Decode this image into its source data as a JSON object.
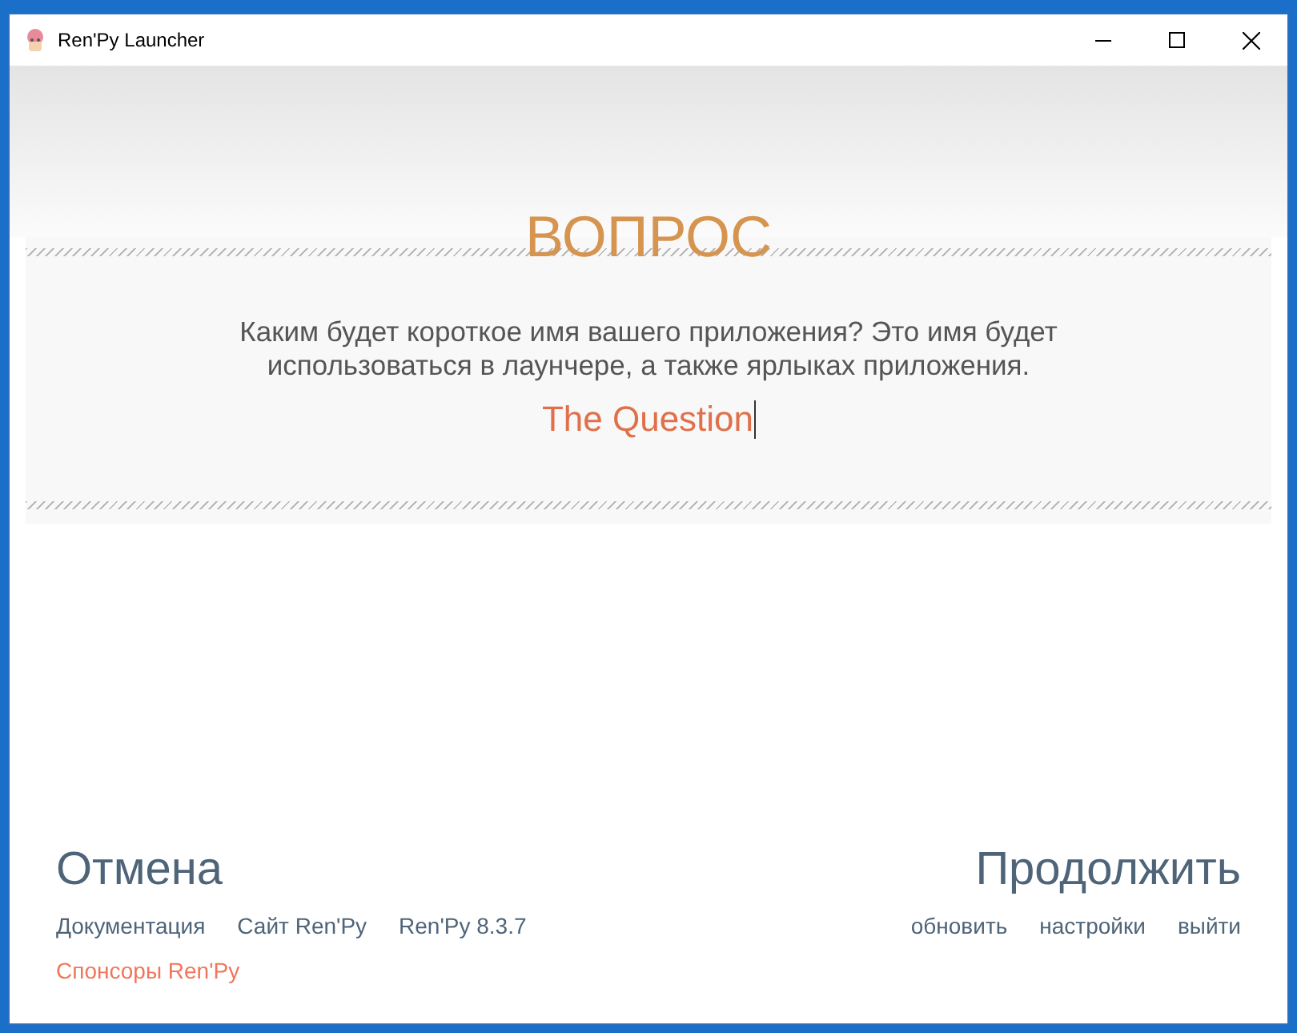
{
  "window": {
    "title": "Ren'Py Launcher"
  },
  "heading": "ВОПРОС",
  "prompt": "Каким будет короткое имя вашего приложения? Это имя будет использоваться в лаунчере, а также ярлыках приложения.",
  "input": {
    "value": "The Question"
  },
  "actions": {
    "cancel": "Отмена",
    "continue": "Продолжить"
  },
  "left_links": [
    {
      "label": "Документация",
      "color": "#4e6479"
    },
    {
      "label": "Сайт Ren'Py",
      "color": "#4e6479"
    },
    {
      "label": "Ren'Py 8.3.7",
      "color": "#4e6479"
    }
  ],
  "sponsor_link": {
    "label": "Спонсоры Ren'Py",
    "color": "#f0765a"
  },
  "right_links": [
    {
      "label": "обновить"
    },
    {
      "label": "настройки"
    },
    {
      "label": "выйти"
    }
  ]
}
